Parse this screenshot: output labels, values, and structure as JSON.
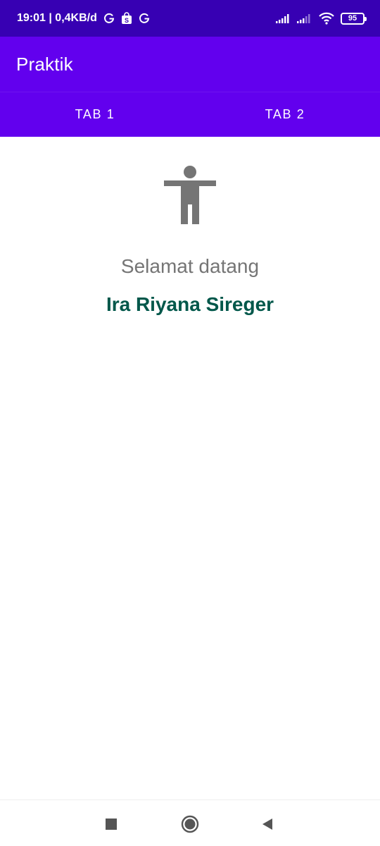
{
  "status_bar": {
    "time_data": "19:01 | 0,4KB/d",
    "battery_level": "95",
    "icons": [
      "g-icon",
      "shopping-bag-icon",
      "g-icon",
      "signal-icon",
      "signal-icon",
      "wifi-icon",
      "battery-icon"
    ]
  },
  "app_bar": {
    "title": "Praktik"
  },
  "tabs": [
    {
      "label": "TAB 1",
      "selected": true
    },
    {
      "label": "TAB 2",
      "selected": false
    }
  ],
  "content": {
    "icon": "accessibility-icon",
    "welcome_text": "Selamat datang",
    "user_name": "Ira Riyana Sireger"
  },
  "nav_bar": {
    "icons": [
      "recents-icon",
      "home-icon",
      "back-icon"
    ]
  },
  "colors": {
    "status_bar": "#3700b3",
    "primary": "#6200ee",
    "name_text": "#01574a",
    "welcome_text": "#757575",
    "icon_gray": "#757575"
  }
}
